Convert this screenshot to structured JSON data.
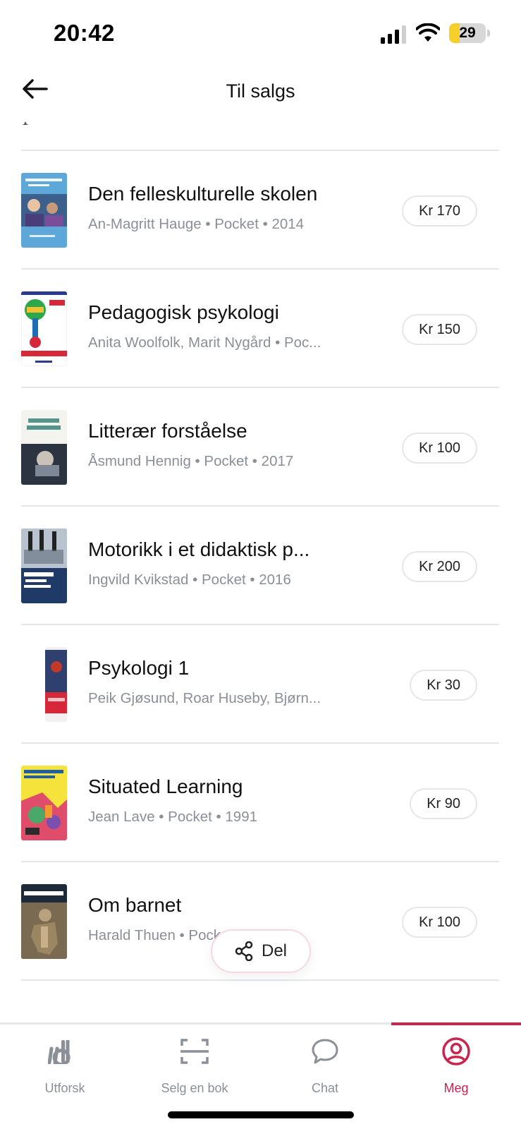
{
  "status_bar": {
    "time": "20:42",
    "battery_percent": 29,
    "battery_text": "29",
    "battery_color": "#f7cf29"
  },
  "header": {
    "back_icon": "arrow-left-icon",
    "title": "Til salgs"
  },
  "books": [
    {
      "title": "Den felleskulturelle skolen",
      "meta": "An-Magritt Hauge • Pocket • 2014",
      "price": "Kr 170"
    },
    {
      "title": "Pedagogisk psykologi",
      "meta": "Anita Woolfolk, Marit Nygård • Poc...",
      "price": "Kr 150"
    },
    {
      "title": "Litterær forståelse",
      "meta": "Åsmund Hennig • Pocket • 2017",
      "price": "Kr 100"
    },
    {
      "title": "Motorikk i et didaktisk p...",
      "meta": "Ingvild Kvikstad • Pocket • 2016",
      "price": "Kr 200"
    },
    {
      "title": "Psykologi 1",
      "meta": "Peik Gjøsund, Roar Huseby, Bjørn...",
      "price": "Kr 30"
    },
    {
      "title": "Situated Learning",
      "meta": "Jean Lave • Pocket • 1991",
      "price": "Kr 90"
    },
    {
      "title": "Om barnet",
      "meta": "Harald Thuen • Pocket",
      "price": "Kr 100"
    }
  ],
  "share": {
    "label": "Del",
    "icon": "share-icon"
  },
  "nav": {
    "items": [
      {
        "label": "Utforsk",
        "icon": "lb-logo-icon"
      },
      {
        "label": "Selg en bok",
        "icon": "scan-icon"
      },
      {
        "label": "Chat",
        "icon": "chat-bubble-icon"
      },
      {
        "label": "Meg",
        "icon": "profile-icon"
      }
    ],
    "active_index": 3,
    "accent_color": "#c8264f",
    "inactive_color": "#8a8f98"
  }
}
